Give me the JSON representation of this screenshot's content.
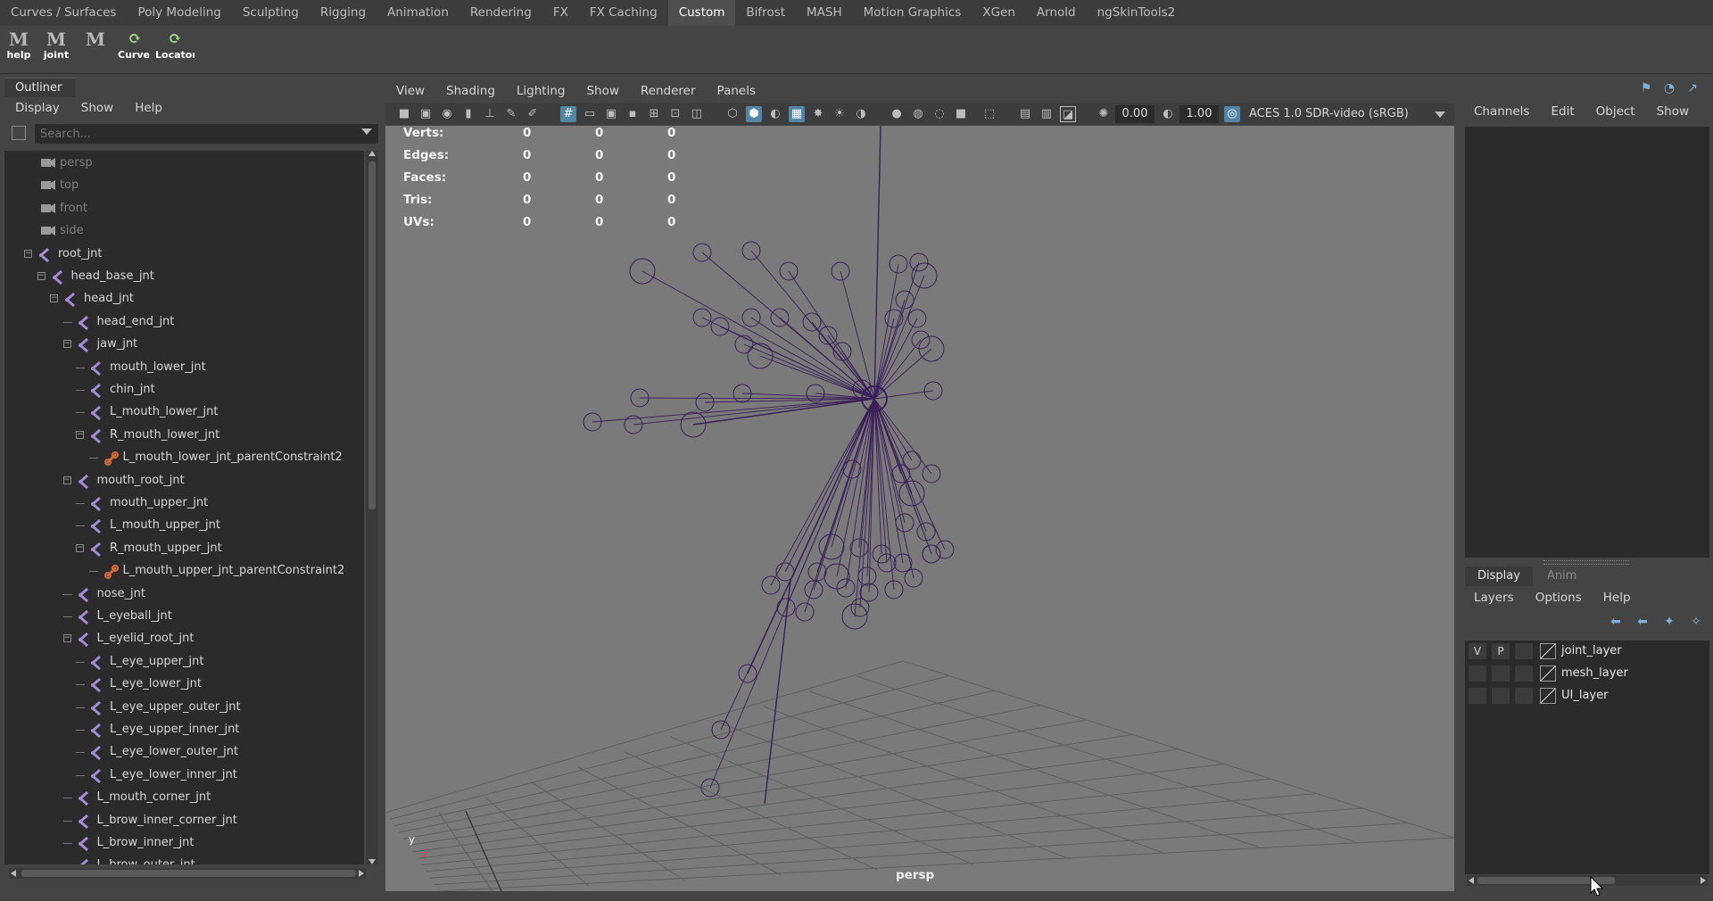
{
  "shelf_tabs": [
    {
      "label": "Curves / Surfaces",
      "active": false
    },
    {
      "label": "Poly Modeling",
      "active": false
    },
    {
      "label": "Sculpting",
      "active": false
    },
    {
      "label": "Rigging",
      "active": false
    },
    {
      "label": "Animation",
      "active": false
    },
    {
      "label": "Rendering",
      "active": false
    },
    {
      "label": "FX",
      "active": false
    },
    {
      "label": "FX Caching",
      "active": false
    },
    {
      "label": "Custom",
      "active": true
    },
    {
      "label": "Bifrost",
      "active": false
    },
    {
      "label": "MASH",
      "active": false
    },
    {
      "label": "Motion Graphics",
      "active": false
    },
    {
      "label": "XGen",
      "active": false
    },
    {
      "label": "Arnold",
      "active": false
    },
    {
      "label": "ngSkinTools2",
      "active": false
    }
  ],
  "shelf_buttons": [
    {
      "label": "help",
      "icon": "maya-m-icon"
    },
    {
      "label": "joint",
      "icon": "maya-m-icon"
    },
    {
      "label": "",
      "icon": "maya-m-icon"
    },
    {
      "label": "Curve C",
      "icon": "python-script-icon"
    },
    {
      "label": "Locator",
      "icon": "python-script-icon"
    }
  ],
  "outliner": {
    "tab_label": "Outliner",
    "menu": [
      "Display",
      "Show",
      "Help"
    ],
    "search_placeholder": "Search...",
    "items": [
      {
        "label": "persp",
        "depth": 0,
        "type": "camera",
        "expander": "none"
      },
      {
        "label": "top",
        "depth": 0,
        "type": "camera",
        "expander": "none"
      },
      {
        "label": "front",
        "depth": 0,
        "type": "camera",
        "expander": "none"
      },
      {
        "label": "side",
        "depth": 0,
        "type": "camera",
        "expander": "none"
      },
      {
        "label": "root_jnt",
        "depth": 0,
        "type": "joint",
        "expander": "minus"
      },
      {
        "label": "head_base_jnt",
        "depth": 1,
        "type": "joint",
        "expander": "minus"
      },
      {
        "label": "head_jnt",
        "depth": 2,
        "type": "joint",
        "expander": "minus"
      },
      {
        "label": "head_end_jnt",
        "depth": 3,
        "type": "joint",
        "expander": "line"
      },
      {
        "label": "jaw_jnt",
        "depth": 3,
        "type": "joint",
        "expander": "minus"
      },
      {
        "label": "mouth_lower_jnt",
        "depth": 4,
        "type": "joint",
        "expander": "line"
      },
      {
        "label": "chin_jnt",
        "depth": 4,
        "type": "joint",
        "expander": "line"
      },
      {
        "label": "L_mouth_lower_jnt",
        "depth": 4,
        "type": "joint",
        "expander": "line"
      },
      {
        "label": "R_mouth_lower_jnt",
        "depth": 4,
        "type": "joint",
        "expander": "minus"
      },
      {
        "label": "L_mouth_lower_jnt_parentConstraint2",
        "depth": 5,
        "type": "constraint",
        "expander": "line"
      },
      {
        "label": "mouth_root_jnt",
        "depth": 3,
        "type": "joint",
        "expander": "minus"
      },
      {
        "label": "mouth_upper_jnt",
        "depth": 4,
        "type": "joint",
        "expander": "line"
      },
      {
        "label": "L_mouth_upper_jnt",
        "depth": 4,
        "type": "joint",
        "expander": "line"
      },
      {
        "label": "R_mouth_upper_jnt",
        "depth": 4,
        "type": "joint",
        "expander": "minus"
      },
      {
        "label": "L_mouth_upper_jnt_parentConstraint2",
        "depth": 5,
        "type": "constraint",
        "expander": "line"
      },
      {
        "label": "nose_jnt",
        "depth": 3,
        "type": "joint",
        "expander": "line"
      },
      {
        "label": "L_eyeball_jnt",
        "depth": 3,
        "type": "joint",
        "expander": "line"
      },
      {
        "label": "L_eyelid_root_jnt",
        "depth": 3,
        "type": "joint",
        "expander": "minus"
      },
      {
        "label": "L_eye_upper_jnt",
        "depth": 4,
        "type": "joint",
        "expander": "line"
      },
      {
        "label": "L_eye_lower_jnt",
        "depth": 4,
        "type": "joint",
        "expander": "line"
      },
      {
        "label": "L_eye_upper_outer_jnt",
        "depth": 4,
        "type": "joint",
        "expander": "line"
      },
      {
        "label": "L_eye_upper_inner_jnt",
        "depth": 4,
        "type": "joint",
        "expander": "line"
      },
      {
        "label": "L_eye_lower_outer_jnt",
        "depth": 4,
        "type": "joint",
        "expander": "line"
      },
      {
        "label": "L_eye_lower_inner_jnt",
        "depth": 4,
        "type": "joint",
        "expander": "line"
      },
      {
        "label": "L_mouth_corner_jnt",
        "depth": 3,
        "type": "joint",
        "expander": "line"
      },
      {
        "label": "L_brow_inner_corner_jnt",
        "depth": 3,
        "type": "joint",
        "expander": "line"
      },
      {
        "label": "L_brow_inner_jnt",
        "depth": 3,
        "type": "joint",
        "expander": "line"
      },
      {
        "label": "L_brow_outer_jnt",
        "depth": 3,
        "type": "joint",
        "expander": "line"
      }
    ]
  },
  "viewport": {
    "menu": [
      "View",
      "Shading",
      "Lighting",
      "Show",
      "Renderer",
      "Panels"
    ],
    "exposure": "0.00",
    "gamma": "1.00",
    "color_space": "ACES 1.0 SDR-video (sRGB)",
    "camera_label": "persp",
    "axis_y": "y",
    "axis_z": "z",
    "hud": [
      {
        "label": "Verts:",
        "values": [
          "0",
          "0",
          "0"
        ]
      },
      {
        "label": "Edges:",
        "values": [
          "0",
          "0",
          "0"
        ]
      },
      {
        "label": "Faces:",
        "values": [
          "0",
          "0",
          "0"
        ]
      },
      {
        "label": "Tris:",
        "values": [
          "0",
          "0",
          "0"
        ]
      },
      {
        "label": "UVs:",
        "values": [
          "0",
          "0",
          "0"
        ]
      }
    ],
    "wire_color": "#3b1e5a"
  },
  "channel_box": {
    "menu": [
      "Channels",
      "Edit",
      "Object",
      "Show"
    ]
  },
  "layer_editor": {
    "tabs": [
      {
        "label": "Display",
        "active": true
      },
      {
        "label": "Anim",
        "active": false
      }
    ],
    "menu": [
      "Layers",
      "Options",
      "Help"
    ],
    "layers": [
      {
        "name": "joint_layer",
        "v": "V",
        "p": "P"
      },
      {
        "name": "mesh_layer",
        "v": "",
        "p": ""
      },
      {
        "name": "UI_layer",
        "v": "",
        "p": ""
      }
    ]
  }
}
